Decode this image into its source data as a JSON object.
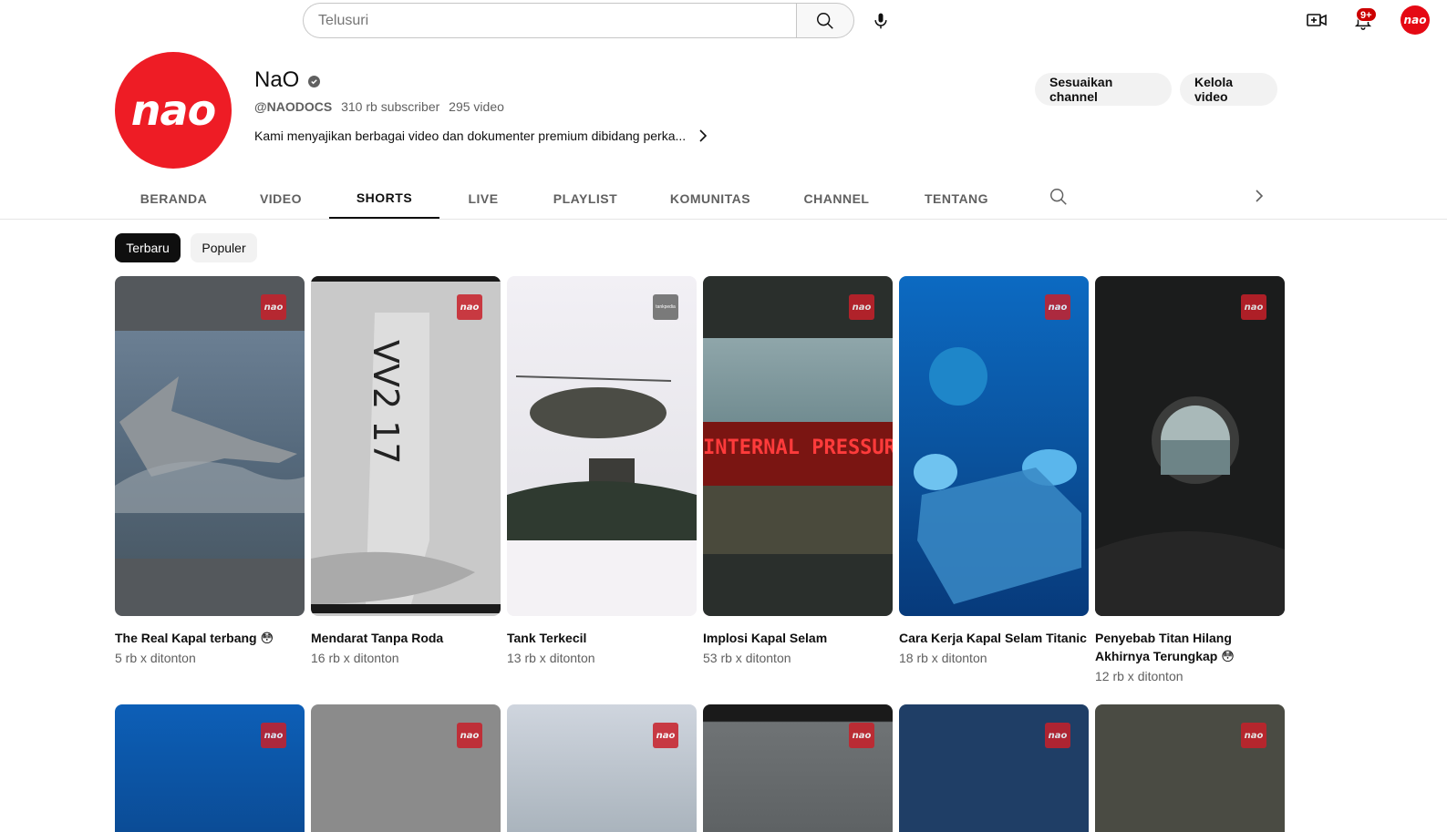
{
  "search": {
    "placeholder": "Telusuri"
  },
  "header": {
    "icons": [
      "search-icon",
      "mic-icon",
      "create-video-icon",
      "bell-icon"
    ],
    "notification_badge": "9+",
    "account_logo": "nao"
  },
  "channel": {
    "logo_text": "nao",
    "name": "NaO",
    "handle": "@NAODOCS",
    "subscribers": "310 rb subscriber",
    "videos": "295 video",
    "description": "Kami menyajikan berbagai video dan dokumenter premium dibidang perka...",
    "customize_button": "Sesuaikan channel",
    "manage_button": "Kelola video",
    "brand_color": "#ee1c25"
  },
  "tabs": [
    {
      "label": "BERANDA"
    },
    {
      "label": "VIDEO"
    },
    {
      "label": "SHORTS",
      "active": true
    },
    {
      "label": "LIVE"
    },
    {
      "label": "PLAYLIST"
    },
    {
      "label": "KOMUNITAS"
    },
    {
      "label": "CHANNEL"
    },
    {
      "label": "TENTANG"
    }
  ],
  "chips": [
    {
      "label": "Terbaru",
      "active": true
    },
    {
      "label": "Populer",
      "active": false
    }
  ],
  "shorts": [
    {
      "title": "The Real Kapal terbang 😳",
      "views": "5 rb x ditonton",
      "watermark": "nao"
    },
    {
      "title": "Mendarat Tanpa Roda",
      "views": "16 rb x ditonton",
      "watermark": "nao",
      "thumb_text": "VV2 17"
    },
    {
      "title": "Tank Terkecil",
      "views": "13 rb x ditonton",
      "watermark": "tankpedia"
    },
    {
      "title": "Implosi Kapal Selam",
      "views": "53 rb x ditonton",
      "watermark": "nao",
      "thumb_text": "INTERNAL PRESSURE"
    },
    {
      "title": "Cara Kerja Kapal Selam Titanic",
      "views": "18 rb x ditonton",
      "watermark": "nao"
    },
    {
      "title": "Penyebab Titan Hilang Akhirnya Terungkap 😳",
      "views": "12 rb x ditonton",
      "watermark": "nao"
    }
  ],
  "shorts_row2": [
    {
      "watermark": "nao"
    },
    {
      "watermark": "nao"
    },
    {
      "watermark": "nao"
    },
    {
      "watermark": "nao"
    },
    {
      "watermark": "nao"
    },
    {
      "watermark": "nao"
    }
  ]
}
